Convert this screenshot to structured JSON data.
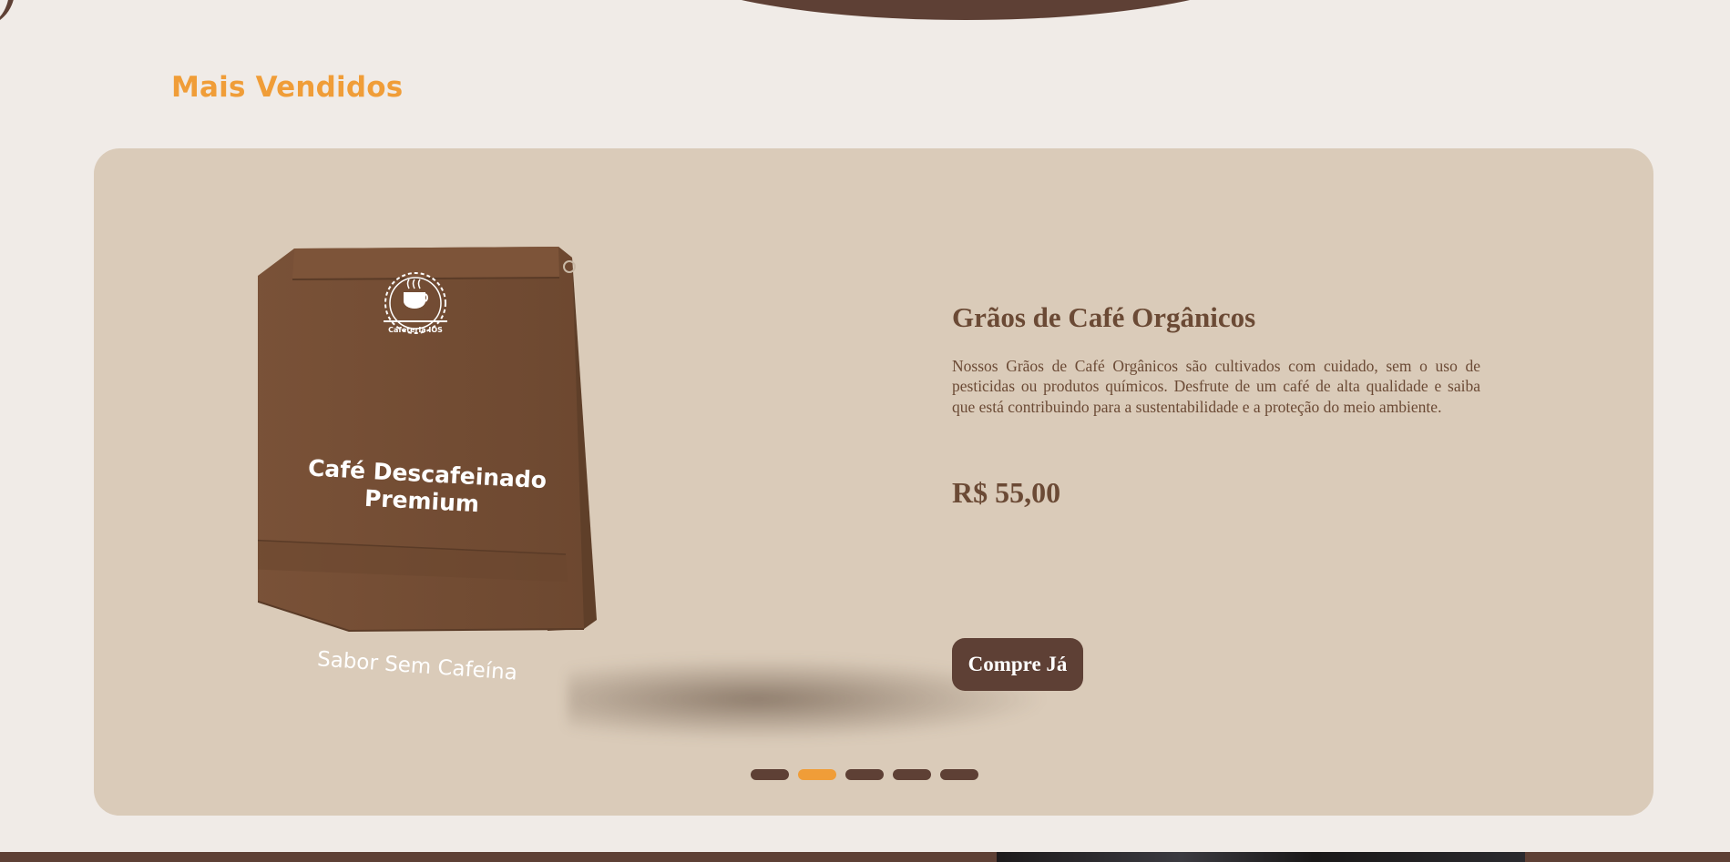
{
  "section": {
    "title": "Mais Vendidos"
  },
  "product": {
    "title": "Grãos de Café Orgânicos",
    "description": "Nossos Grãos de Café Orgânicos são cultivados com cuidado, sem o uso de pesticidas ou produtos químicos. Desfrute de um café de alta qualidade e saiba que está contribuindo para a sustentabilidade e a proteção do meio ambiente.",
    "price": "R$ 55,00",
    "buy_label": "Compre Já"
  },
  "bag": {
    "logo": "Cafeteria IOS",
    "name_line1": "Café Descafeinado",
    "name_line2": "Premium",
    "tagline": "Sabor Sem Cafeína"
  },
  "carousel": {
    "total": 5,
    "active_index": 2
  },
  "colors": {
    "accent": "#f09d38",
    "brand_brown": "#5e4035",
    "card_bg": "#dacbb9",
    "page_bg": "#f0ebe7",
    "text_brown": "#6b4a35"
  }
}
